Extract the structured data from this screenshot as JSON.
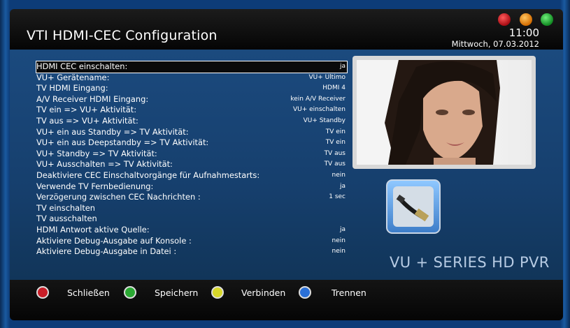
{
  "header": {
    "title": "VTI HDMI-CEC Configuration",
    "time": "11:00",
    "date": "Mittwoch, 07.03.2012"
  },
  "colors": {
    "red": "#c81e28",
    "orange": "#e88c10",
    "green": "#2aa833",
    "yellow": "#d8d82a",
    "blue": "#2a70d8"
  },
  "settings": [
    {
      "label": "HDMI CEC einschalten:",
      "value": "ja",
      "selected": true
    },
    {
      "label": "VU+ Gerätename:",
      "value": "VU+ Ultimo"
    },
    {
      "label": "TV HDMI Eingang:",
      "value": "HDMI 4"
    },
    {
      "label": "A/V Receiver HDMI Eingang:",
      "value": "kein A/V Receiver"
    },
    {
      "label": "TV ein  => VU+ Aktivität:",
      "value": "VU+ einschalten"
    },
    {
      "label": "TV aus => VU+ Aktivität:",
      "value": "VU+ Standby"
    },
    {
      "label": "VU+ ein aus Standby => TV Aktivität:",
      "value": "TV ein"
    },
    {
      "label": "VU+ ein aus Deepstandby => TV Aktivität:",
      "value": "TV ein"
    },
    {
      "label": "VU+ Standby => TV Aktivität:",
      "value": "TV aus"
    },
    {
      "label": "VU+ Ausschalten => TV Aktivität:",
      "value": "TV aus"
    },
    {
      "label": "Deaktiviere CEC Einschaltvorgänge für Aufnahmestarts:",
      "value": "nein"
    },
    {
      "label": "Verwende TV Fernbedienung:",
      "value": "ja"
    },
    {
      "label": "Verzögerung zwischen CEC Nachrichten :",
      "value": "1 sec"
    },
    {
      "label": "TV einschalten",
      "value": ""
    },
    {
      "label": "TV ausschalten",
      "value": ""
    },
    {
      "label": "HDMI Antwort aktive Quelle:",
      "value": "ja"
    },
    {
      "label": "Aktiviere Debug-Ausgabe auf Konsole :",
      "value": "nein"
    },
    {
      "label": "Aktiviere Debug-Ausgabe in Datei :",
      "value": "nein"
    }
  ],
  "brand": "VU + SERIES HD PVR",
  "icons": {
    "cec": "hdmi-cable-icon",
    "preview": "tv-preview-image"
  },
  "buttons": [
    {
      "label": "Schließen",
      "color": "red"
    },
    {
      "label": "Speichern",
      "color": "green"
    },
    {
      "label": "Verbinden",
      "color": "yellow"
    },
    {
      "label": "Trennen",
      "color": "blue"
    }
  ]
}
